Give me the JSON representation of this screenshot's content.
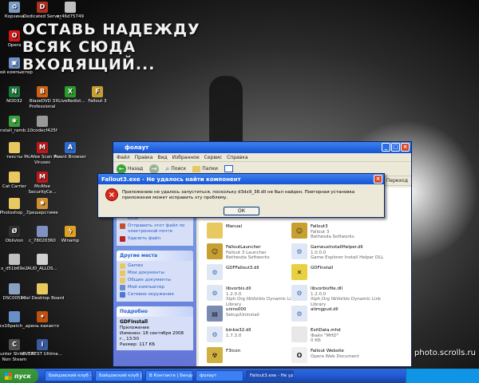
{
  "wallpaper": {
    "lines": [
      "ОСТАВЬ НАДЕЖДУ",
      "ВСЯК СЮДА",
      "ВХОДЯЩИЙ..."
    ]
  },
  "desktop_icons": [
    {
      "label": "Корзина",
      "icon": "recycle-bin-icon",
      "color": "#7a9cc8",
      "glyph": "♻"
    },
    {
      "label": "Dedicated Server",
      "icon": "dedicated-server-icon",
      "color": "#b03020",
      "glyph": "D"
    },
    {
      "label": "x_46d75749",
      "icon": "file-icon",
      "color": "#c0c0c0",
      "glyph": ""
    },
    {
      "label": "Opera",
      "icon": "opera-icon",
      "color": "#d01818",
      "glyph": "O"
    },
    {
      "label": "Мой компьютер",
      "icon": "my-computer-icon",
      "color": "#6a8fc8",
      "glyph": "▣"
    },
    {
      "label": "NOD32",
      "icon": "nod32-icon",
      "color": "#1a7a3a",
      "glyph": "N"
    },
    {
      "label": "BlazeDVD 3 Professional",
      "icon": "blazedvd-icon",
      "color": "#d06010",
      "glyph": "B"
    },
    {
      "label": "XLiveRedist...",
      "icon": "xlive-icon",
      "color": "#2a9a2a",
      "glyph": "X"
    },
    {
      "label": "Fallout 3",
      "icon": "fallout3-icon",
      "color": "#c8a030",
      "glyph": "F"
    },
    {
      "label": "install_ramb...",
      "icon": "install-icon",
      "color": "#3aa03a",
      "glyph": "✱"
    },
    {
      "label": "10codecf425f",
      "icon": "codec-icon",
      "color": "#999999",
      "glyph": ""
    },
    {
      "label": "тексты",
      "icon": "folder-icon",
      "color": "#e8c860",
      "glyph": ""
    },
    {
      "label": "McAfee Scan For Viruses",
      "icon": "mcafee-scan-icon",
      "color": "#c01818",
      "glyph": "M"
    },
    {
      "label": "Avant Browser",
      "icon": "avant-browser-icon",
      "color": "#2a6ad0",
      "glyph": "A"
    },
    {
      "label": "Cat Carrier",
      "icon": "folder-icon",
      "color": "#e8c860",
      "glyph": ""
    },
    {
      "label": "McAfee SecurityCe...",
      "icon": "mcafee-icon",
      "color": "#c01818",
      "glyph": "M"
    },
    {
      "label": "Photoshop_...",
      "icon": "photoshop-icon",
      "color": "#e8c860",
      "glyph": ""
    },
    {
      "label": "Трешерстиме",
      "icon": "app-icon",
      "color": "#d09030",
      "glyph": "✹"
    },
    {
      "label": "Oblivion",
      "icon": "oblivion-icon",
      "color": "#303030",
      "glyph": "Ø"
    },
    {
      "label": "c_78020360",
      "icon": "file-icon",
      "color": "#8090c0",
      "glyph": ""
    },
    {
      "label": "Winamp",
      "icon": "winamp-icon",
      "color": "#e0a020",
      "glyph": "ϟ"
    },
    {
      "label": "x_d51b69e2",
      "icon": "file-icon",
      "color": "#c0c0c0",
      "glyph": ""
    },
    {
      "label": "AUD_ALLOS...",
      "icon": "file-icon",
      "color": "#d0d0d0",
      "glyph": ""
    },
    {
      "label": "DSC00510",
      "icon": "image-icon",
      "color": "#8aa0c0",
      "glyph": ""
    },
    {
      "label": "Intel Desktop Board",
      "icon": "folder-icon",
      "color": "#e8c860",
      "glyph": ""
    },
    {
      "label": "cs16patch_...",
      "icon": "patch-icon",
      "color": "#6a8fc8",
      "glyph": ""
    },
    {
      "label": "хрень какакто",
      "icon": "shortcut-icon",
      "color": "#c05010",
      "glyph": "✦"
    },
    {
      "label": "Counter Strike 1.6 Non Steam",
      "icon": "counter-strike-icon",
      "color": "#505050",
      "glyph": "C"
    },
    {
      "label": "EVEREST Ultima...",
      "icon": "everest-icon",
      "color": "#3a5aa0",
      "glyph": "i"
    }
  ],
  "explorer": {
    "title": "фолаут",
    "menu": [
      "Файл",
      "Правка",
      "Вид",
      "Избранное",
      "Сервис",
      "Справка"
    ],
    "toolbar": {
      "back": "Назад",
      "search": "Поиск",
      "folders": "Папки"
    },
    "go": "Переход",
    "left_panels": {
      "tasks_links": [
        {
          "label": "Опубликовать файл в вебе",
          "icon": "publish-icon"
        },
        {
          "label": "Отправить этот файл по электронной почте",
          "icon": "email-icon"
        },
        {
          "label": "Удалить файл",
          "icon": "delete-icon"
        }
      ],
      "other_places_title": "Другие места",
      "other_places": [
        {
          "label": "Games",
          "icon": "folder-icon"
        },
        {
          "label": "Мои документы",
          "icon": "my-documents-icon"
        },
        {
          "label": "Общие документы",
          "icon": "shared-documents-icon"
        },
        {
          "label": "Мой компьютер",
          "icon": "my-computer-icon"
        },
        {
          "label": "Сетевое окружение",
          "icon": "network-icon"
        }
      ],
      "details_title": "Подробно",
      "details": {
        "name": "GDFInstall",
        "type": "Приложение",
        "modified": "Изменен: 18 сентября 2008 г., 13:50",
        "size": "Размер: 117 КБ"
      }
    },
    "files": [
      {
        "name": "Manual",
        "sub1": "",
        "sub2": "",
        "icon": "folder-icon"
      },
      {
        "name": "Fallout3",
        "sub1": "Fallout 3",
        "sub2": "Bethesda Softworks",
        "icon": "fallout3-icon"
      },
      {
        "name": "FalloutLauncher",
        "sub1": "Fallout 3 Launcher",
        "sub2": "Bethesda Softworks",
        "icon": "fallout-launcher-icon"
      },
      {
        "name": "GameuxInstallHelper.dll",
        "sub1": "1.0.0.0",
        "sub2": "Game Explorer Install Helper DLL",
        "icon": "dll-icon"
      },
      {
        "name": "GDFFallout3.dll",
        "sub1": "",
        "sub2": "",
        "icon": "dll-icon"
      },
      {
        "name": "GDFInstall",
        "sub1": "",
        "sub2": "",
        "icon": "gdfinstall-icon"
      },
      {
        "name": "libvorbis.dll",
        "sub1": "1.2.0.0",
        "sub2": "Xiph.Org libVorbis Dynamic Link Library",
        "icon": "dll-icon"
      },
      {
        "name": "libvorbisfile.dll",
        "sub1": "1.2.0.0",
        "sub2": "Xiph.Org libVorbis Dynamic Link Library",
        "icon": "dll-icon"
      },
      {
        "name": "unins000",
        "sub1": "Setup/Uninstall",
        "sub2": "",
        "icon": "uninstall-icon"
      },
      {
        "name": "atimgpud.dll",
        "sub1": "",
        "sub2": "",
        "icon": "dll-icon"
      },
      {
        "name": "binkw32.dll",
        "sub1": "1.7.3.0",
        "sub2": "",
        "icon": "dll-icon"
      },
      {
        "name": "ExitData.mhd",
        "sub1": "Файл \"MHD\"",
        "sub2": "0 КБ",
        "icon": "file-icon"
      },
      {
        "name": "F3icon",
        "sub1": "",
        "sub2": "",
        "icon": "f3-icon"
      },
      {
        "name": "Fallout Website",
        "sub1": "Opera Web Document",
        "sub2": "",
        "icon": "opera-document-icon"
      }
    ]
  },
  "error_dialog": {
    "title": "Fallout3.exe - Не удалось найти компонент",
    "message": "Приложению не удалось запуститься, поскольку d3dx9_38.dll не был найден. Повторная установка приложения может исправить эту проблему.",
    "ok": "ОК"
  },
  "taskbar": {
    "start": "пуск",
    "tasks": [
      {
        "label": "Бойцовский клуб - М..."
      },
      {
        "label": "Бойцовский клуб | ..."
      },
      {
        "label": "В Контакте | Бенде..."
      },
      {
        "label": "фолаут"
      },
      {
        "label": "Fallout3.exe - Не уд...",
        "active": true
      }
    ]
  },
  "watermark": "photo.scrolls.ru"
}
